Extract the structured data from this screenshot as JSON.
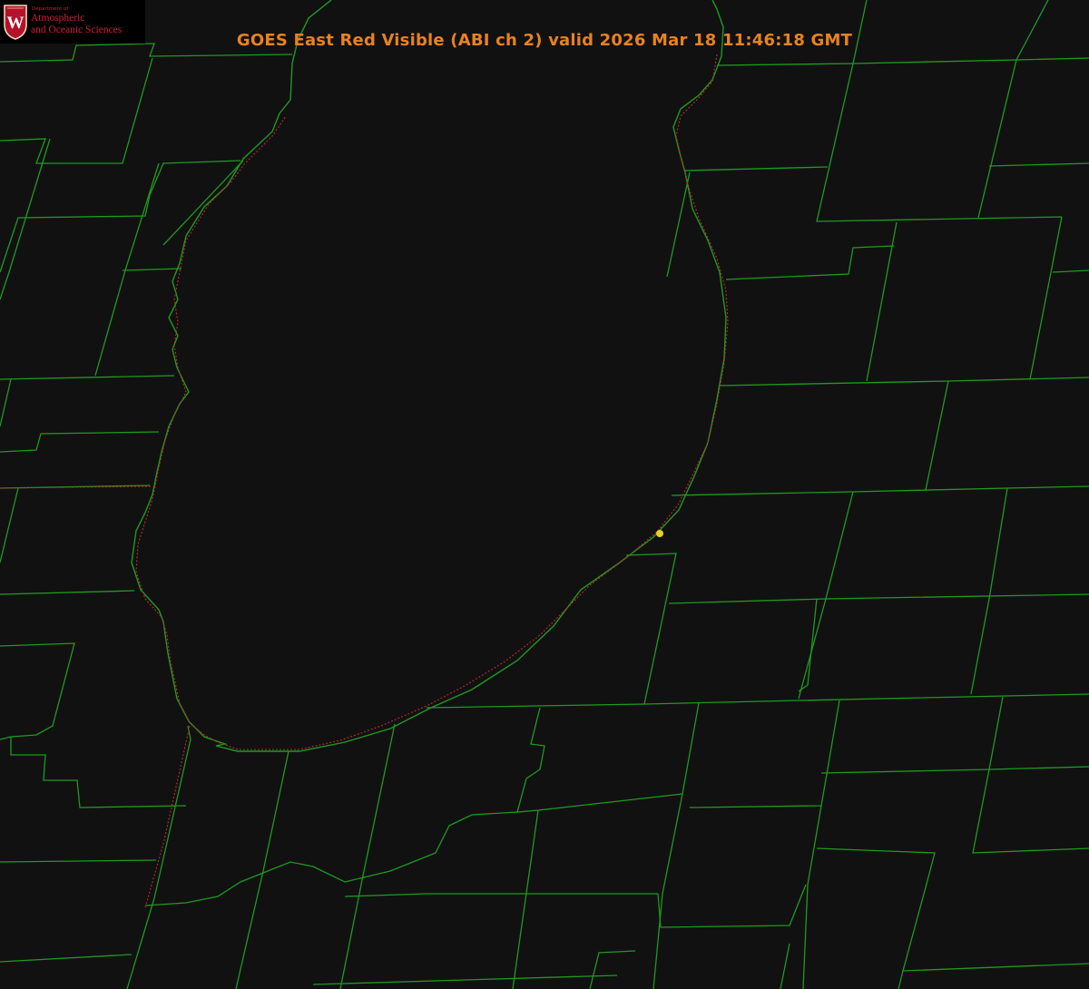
{
  "title": {
    "text": "GOES East Red Visible (ABI ch 2) valid 2026 Mar 18 11:46:18 GMT",
    "color": "#e8821e"
  },
  "logo": {
    "department": "Department of",
    "name_line1": "Atmospheric",
    "name_line2": "and Oceanic Sciences",
    "crest_letter": "W",
    "text_color": "#c9203a",
    "crest_color": "#b5122a"
  },
  "colors": {
    "background": "#111112",
    "county_lines": "#1f9a1f",
    "state_line": "#c02a2a",
    "marker": "#e6d21e"
  },
  "map": {
    "product": "visible satellite imagery",
    "overlays": [
      "county-boundaries",
      "state-boundaries",
      "lake-shoreline",
      "location-marker"
    ]
  }
}
